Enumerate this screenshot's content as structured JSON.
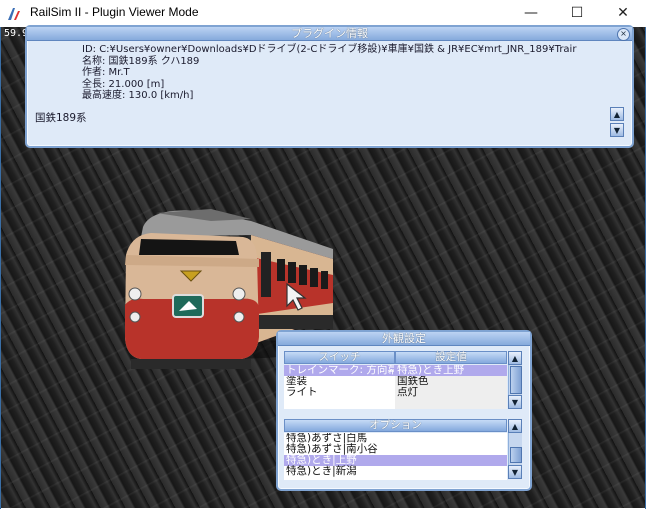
{
  "window": {
    "title": "RailSim II - Plugin Viewer Mode",
    "minimize": "—",
    "maximize": "☐",
    "close": "✕",
    "icon": "railsim-app-icon"
  },
  "viewport": {
    "fps": "59.92 FPS"
  },
  "plugin_info": {
    "title": "プラグイン情報",
    "close_icon": "close-icon",
    "lines": [
      "ID: C:¥Users¥owner¥Downloads¥Dドライブ(2-Cドライブ移設)¥車庫¥国鉄 & JR¥EC¥mrt_JNR_189¥Trair",
      "名称: 国鉄189系 クハ189",
      "作者: Mr.T",
      "全長: 21.000 [m]",
      "最高速度: 130.0 [km/h]"
    ],
    "description": "国鉄189系",
    "scroll_up": "▲",
    "scroll_down": "▼"
  },
  "appearance": {
    "title": "外観設定",
    "switch_header": "スイッチ",
    "value_header": "設定値",
    "switch_rows": [
      {
        "name": "トレインマーク: 方向幕",
        "value": "特急)とき上野",
        "selected": true
      },
      {
        "name": "塗装",
        "value": "国鉄色",
        "selected": false
      },
      {
        "name": "ライト",
        "value": "点灯",
        "selected": false
      }
    ],
    "option_header": "オプション",
    "option_rows": [
      {
        "label": "特急)あずさ|白馬",
        "selected": false
      },
      {
        "label": "特急)あずさ|南小谷",
        "selected": false
      },
      {
        "label": "特急)とき|上野",
        "selected": true
      },
      {
        "label": "特急)とき|新潟",
        "selected": false
      }
    ],
    "scroll_up": "▲",
    "scroll_down": "▼"
  }
}
